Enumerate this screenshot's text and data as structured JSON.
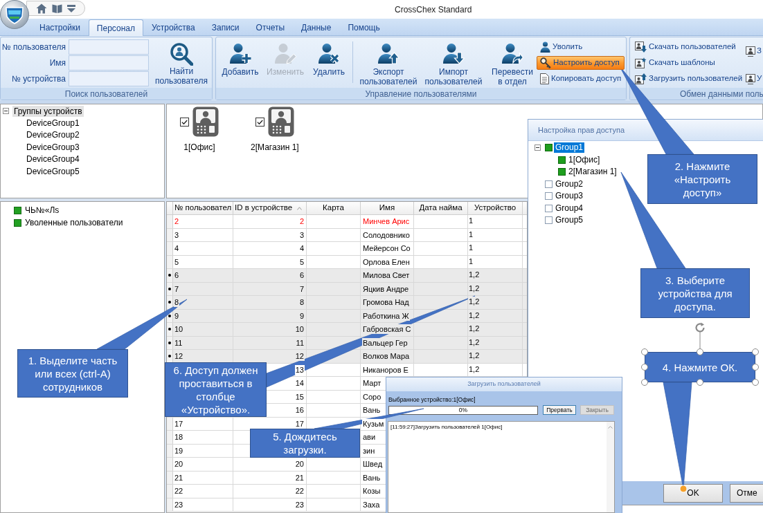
{
  "window": {
    "title": "CrossChex Standard"
  },
  "tabs": [
    {
      "label": "Настройки",
      "selected": false
    },
    {
      "label": "Персонал",
      "selected": true
    },
    {
      "label": "Устройства",
      "selected": false
    },
    {
      "label": "Записи",
      "selected": false
    },
    {
      "label": "Отчеты",
      "selected": false
    },
    {
      "label": "Данные",
      "selected": false
    },
    {
      "label": "Помощь",
      "selected": false
    }
  ],
  "ribbon": {
    "search_group": {
      "fields": [
        {
          "label": "№ пользователя"
        },
        {
          "label": "Имя"
        },
        {
          "label": "№ устройства"
        }
      ],
      "button": "Найти\nпользователя",
      "label": "Поиск пользователей"
    },
    "users_group": {
      "edit_buttons": [
        {
          "label": "Добавить",
          "disabled": false
        },
        {
          "label": "Изменить",
          "disabled": true
        },
        {
          "label": "Удалить",
          "disabled": false
        }
      ],
      "transfer_buttons": [
        {
          "label": "Экспорт\nпользователей"
        },
        {
          "label": "Импорт\nпользователей"
        },
        {
          "label": "Перевести\nв отдел"
        }
      ],
      "small_buttons": [
        {
          "label": "Уволить",
          "highlighted": false
        },
        {
          "label": "Настроить доступ",
          "highlighted": true
        },
        {
          "label": "Копировать доступ",
          "highlighted": false
        }
      ],
      "label": "Управление пользователями"
    },
    "exchange_group": {
      "small_buttons": [
        "Скачать пользователей",
        "Скачать шаблоны",
        "Загрузить пользователей"
      ],
      "cut_buttons": [
        "З",
        "У"
      ],
      "label": "Обмен данными поль"
    }
  },
  "device_tree": {
    "label": "Группы устройств",
    "expanded": true,
    "selected": true,
    "children": [
      {
        "label": "DeviceGroup1",
        "selected": false
      },
      {
        "label": "DeviceGroup2",
        "selected": false
      },
      {
        "label": "DeviceGroup3",
        "selected": false
      },
      {
        "label": "DeviceGroup4",
        "selected": false
      },
      {
        "label": "DeviceGroup5",
        "selected": false
      }
    ]
  },
  "devices": [
    {
      "label": "1[Офис]",
      "checked": true
    },
    {
      "label": "2[Магазин 1]",
      "checked": true
    }
  ],
  "user_groups": [
    {
      "label": "ЧЬ№«Лѕ"
    },
    {
      "label": "Уволенные пользователи"
    }
  ],
  "table": {
    "columns": [
      {
        "label": "№ пользовател",
        "sorted": false
      },
      {
        "label": "ID в устройстве",
        "sorted": true
      },
      {
        "label": "Карта",
        "sorted": false
      },
      {
        "label": "Имя",
        "sorted": false
      },
      {
        "label": "Дата найма",
        "sorted": false
      },
      {
        "label": "Устройство",
        "sorted": false
      }
    ],
    "rows": [
      {
        "user_no": "2",
        "device_id": "2",
        "name": "Минчев Арис",
        "devices": "1",
        "selected": false,
        "highlighted": true
      },
      {
        "user_no": "3",
        "device_id": "3",
        "name": "Солодовнико",
        "devices": "1",
        "selected": false,
        "highlighted": false
      },
      {
        "user_no": "4",
        "device_id": "4",
        "name": "Мейерсон Со",
        "devices": "1",
        "selected": false,
        "highlighted": false
      },
      {
        "user_no": "5",
        "device_id": "5",
        "name": "Орлова Елен",
        "devices": "1",
        "selected": false,
        "highlighted": false
      },
      {
        "user_no": "6",
        "device_id": "6",
        "name": "Милова Свет",
        "devices": "1,2",
        "selected": true,
        "highlighted": false
      },
      {
        "user_no": "7",
        "device_id": "7",
        "name": "Яцкив Андре",
        "devices": "1,2",
        "selected": true,
        "highlighted": false
      },
      {
        "user_no": "8",
        "device_id": "8",
        "name": "Громова Над",
        "devices": "1,2",
        "selected": true,
        "highlighted": false
      },
      {
        "user_no": "9",
        "device_id": "9",
        "name": "Работкина Ж",
        "devices": "1,2",
        "selected": true,
        "highlighted": false
      },
      {
        "user_no": "10",
        "device_id": "10",
        "name": "Габровская С",
        "devices": "1,2",
        "selected": true,
        "highlighted": false
      },
      {
        "user_no": "11",
        "device_id": "11",
        "name": "Вальцер Гер",
        "devices": "1,2",
        "selected": true,
        "highlighted": false
      },
      {
        "user_no": "12",
        "device_id": "12",
        "name": "Волков Мара",
        "devices": "1,2",
        "selected": true,
        "highlighted": false
      },
      {
        "device_id": "13",
        "name": "Никаноров Е",
        "devices": "1,2",
        "selected": false,
        "highlighted": false
      },
      {
        "device_id": "14",
        "name": "Март",
        "selected": false,
        "highlighted": false
      },
      {
        "device_id": "15",
        "name": "Соро",
        "selected": false,
        "highlighted": false
      },
      {
        "device_id": "16",
        "name": "Вань",
        "selected": false,
        "highlighted": false
      },
      {
        "user_no": "17",
        "device_id": "17",
        "name": "Кузьм",
        "selected": false,
        "highlighted": false
      },
      {
        "user_no": "18",
        "name": "ави",
        "selected": false,
        "highlighted": false
      },
      {
        "user_no": "19",
        "name": "зин",
        "selected": false,
        "highlighted": false
      },
      {
        "user_no": "20",
        "device_id": "20",
        "name": "Швед",
        "selected": false,
        "highlighted": false
      },
      {
        "user_no": "21",
        "device_id": "21",
        "name": "Вань",
        "selected": false,
        "highlighted": false
      },
      {
        "user_no": "22",
        "device_id": "22",
        "name": "Козы",
        "selected": false,
        "highlighted": false
      },
      {
        "user_no": "23",
        "device_id": "23",
        "name": "Заха",
        "selected": false,
        "highlighted": false
      }
    ]
  },
  "access_dialog": {
    "title": "Настройка прав доступа",
    "tree": [
      {
        "label": "Group1",
        "checked": true,
        "selected": true,
        "expanded": true,
        "children": [
          {
            "label": "1[Офис]",
            "checked": true,
            "selected": false
          },
          {
            "label": "2[Магазин 1]",
            "checked": true,
            "selected": false
          }
        ]
      },
      {
        "label": "Group2",
        "checked": false,
        "selected": false
      },
      {
        "label": "Group3",
        "checked": false,
        "selected": false
      },
      {
        "label": "Group4",
        "checked": false,
        "selected": false
      },
      {
        "label": "Group5",
        "checked": false,
        "selected": false
      }
    ],
    "buttons": [
      "OK",
      "Отме"
    ]
  },
  "upload_dialog": {
    "title": "Загрузить пользователей",
    "device_label": "Выбранное устройство:1[Офис]",
    "progress": {
      "level": 0,
      "reading": "0%"
    },
    "buttons": [
      {
        "label": "Прервать",
        "disabled": false
      },
      {
        "label": "Закрыть",
        "disabled": true
      }
    ],
    "log": [
      "[11:59:27]Загрузить пользователей 1[Офис]"
    ]
  },
  "callouts": [
    {
      "text": "1. Выделите часть или всех (ctrl-A) сотрудников",
      "selected": false
    },
    {
      "text": "2. Нажмите «Настроить доступ»",
      "selected": false
    },
    {
      "text": "3. Выберите устройства для доступа.",
      "selected": false
    },
    {
      "text": "4. Нажмите ОК.",
      "selected": true
    },
    {
      "text": "5. Дождитесь загрузки.",
      "selected": false
    },
    {
      "text": "6. Доступ должен проставиться в столбце «Устройство».",
      "selected": false
    }
  ]
}
